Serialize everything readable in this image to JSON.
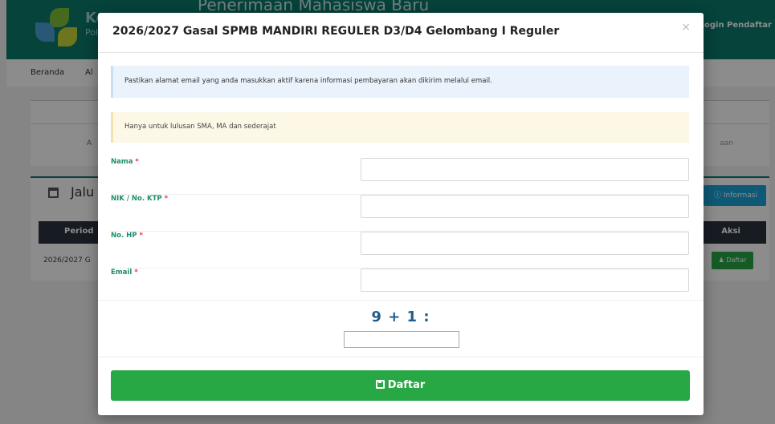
{
  "background": {
    "brand_text": "Ke",
    "brand_sub": "Polt",
    "header_title": "Penerimaan Mahasiswa Baru",
    "login_link": "Login Pendaftar",
    "nav": [
      "Beranda",
      "Al"
    ],
    "panel_tab_left": "A",
    "panel_tab_right": "aan",
    "section_title": "Jalu",
    "info_button": "Informasi",
    "table_headers": [
      "Period",
      "Aksi"
    ],
    "table_row_text": "2026/2027 G",
    "row_button": "Daftar",
    "accent_color": "#0a7a6c"
  },
  "modal": {
    "title": "2026/2027 Gasal SPMB MANDIRI REGULER D3/D4 Gelombang I Reguler",
    "close_symbol": "×",
    "alert_info": "Pastikan alamat email yang anda masukkan aktif karena informasi pembayaran akan dikirim melalui email.",
    "alert_warning": "Hanya untuk lulusan SMA, MA dan sederajat",
    "fields": [
      {
        "label": "Nama",
        "required": "*",
        "value": ""
      },
      {
        "label": "NIK / No. KTP",
        "required": "*",
        "value": ""
      },
      {
        "label": "No. HP",
        "required": "*",
        "value": ""
      },
      {
        "label": "Email",
        "required": "*",
        "value": ""
      }
    ],
    "captcha_question": "9 + 1 :",
    "captcha_value": "",
    "submit_label": "Daftar",
    "submit_icon": "save-icon",
    "submit_color": "#28a745"
  }
}
